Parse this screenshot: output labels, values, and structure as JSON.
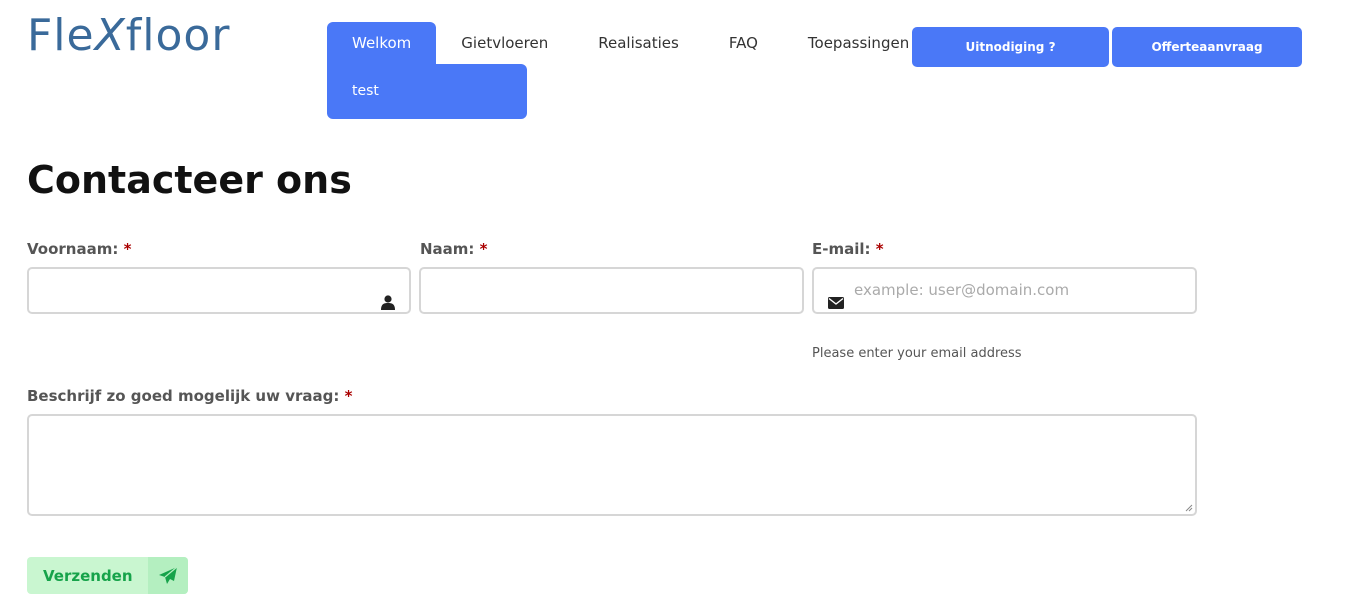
{
  "brand": {
    "logo_pre": "Fle",
    "logo_x": "X",
    "logo_post": "floor"
  },
  "nav": {
    "items": [
      "Welkom",
      "Gietvloeren",
      "Realisaties",
      "FAQ",
      "Toepassingen"
    ],
    "submenu_item": "test",
    "buttons": [
      "Uitnodiging ?",
      "Offerteaanvraag"
    ]
  },
  "page": {
    "title": "Contacteer ons"
  },
  "form": {
    "required_mark": "*",
    "firstname_label": "Voornaam:",
    "lastname_label": "Naam:",
    "email_label": "E-mail:",
    "email_placeholder": "example: user@domain.com",
    "email_helper": "Please enter your email address",
    "question_label": "Beschrijf zo goed mogelijk uw vraag:",
    "submit_label": "Verzenden"
  },
  "colors": {
    "accent": "#4a78f7",
    "submit_bg": "#c9f6d0",
    "submit_text": "#16a34a",
    "required": "#aa0000"
  },
  "icons": {
    "firstname": "user-icon",
    "email": "envelope-icon",
    "submit": "paper-plane-icon"
  }
}
